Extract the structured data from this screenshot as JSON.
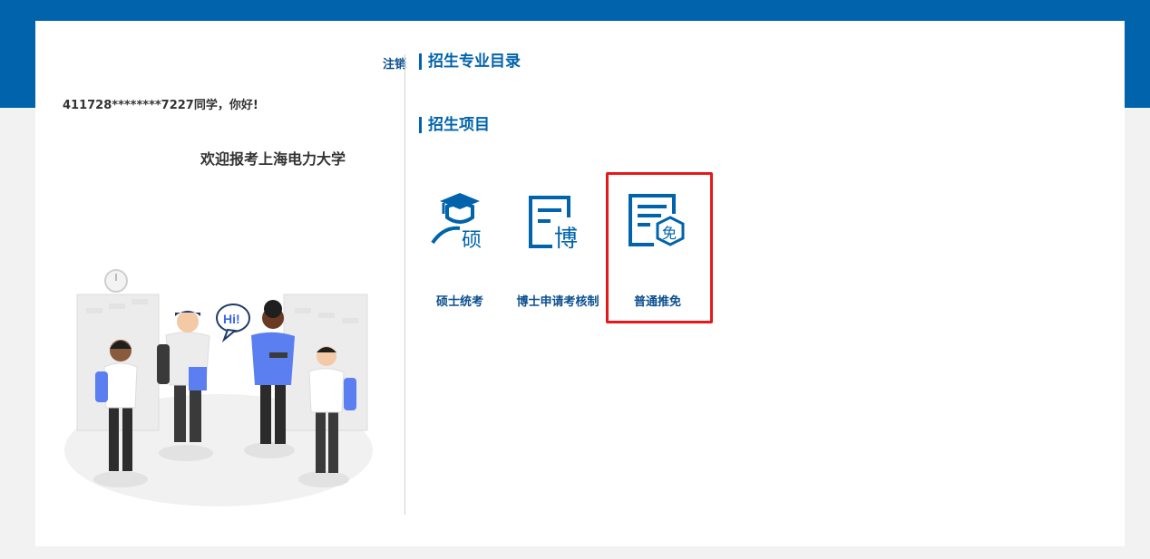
{
  "header": {
    "logout_label": "注销",
    "greeting": "411728********7227同学，你好!",
    "welcome": "欢迎报考上海电力大学",
    "speech_bubble": "Hi!"
  },
  "sections": {
    "catalog_title": "招生专业目录",
    "projects_title": "招生项目"
  },
  "projects": [
    {
      "label": "硕士统考",
      "icon": "master-exam-icon",
      "glyph": "硕"
    },
    {
      "label": "博士申请考核制",
      "icon": "doctoral-application-icon",
      "glyph": "博"
    },
    {
      "label": "普通推免",
      "icon": "recommendation-exempt-icon",
      "glyph": "免"
    }
  ],
  "colors": {
    "brand_blue": "#0063ac",
    "highlight_red": "#e8181a"
  }
}
